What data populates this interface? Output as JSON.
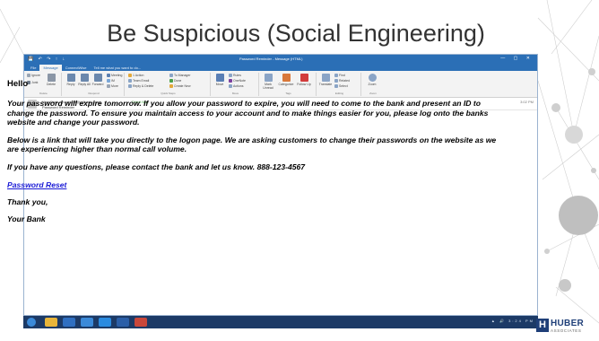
{
  "slide": {
    "title": "Be Suspicious (Social Engineering)"
  },
  "window": {
    "title": "Password Reminder - Message (HTML)",
    "tabs": [
      "File",
      "Message",
      "ConnectWise",
      "Tell me what you want to do..."
    ],
    "ribbon": {
      "delete_group": {
        "label": "Delete",
        "ignore": "Ignore",
        "junk": "Junk",
        "delete": "Delete"
      },
      "respond_group": {
        "label": "Respond",
        "reply": "Reply",
        "reply_all": "Reply All",
        "forward": "Forward",
        "meeting": "Meeting",
        "im": "IM",
        "more": "More"
      },
      "quick_steps_group": {
        "label": "Quick Steps",
        "items": [
          "1 Action",
          "Team Email",
          "Reply & Delete",
          "To Manager",
          "Done",
          "Create New"
        ]
      },
      "move_group": {
        "label": "Move",
        "move": "Move",
        "rules": "Rules",
        "onenote": "OneNote",
        "actions": "Actions"
      },
      "tags_group": {
        "label": "Tags",
        "mark_unread": "Mark Unread",
        "categorize": "Categorize",
        "follow_up": "Follow Up"
      },
      "editing_group": {
        "label": "Editing",
        "translate": "Translate",
        "find": "Find",
        "related": "Related",
        "select": "Select"
      },
      "zoom_group": {
        "label": "Zoom",
        "zoom": "Zoom"
      }
    },
    "header": {
      "from": "Your Bank <yourbank@ydbank.com>",
      "flag": "Direct flag",
      "subject": "Password Reminder",
      "time": "3:02 PM"
    }
  },
  "email": {
    "greeting": "Hello",
    "paragraphs": [
      "Your password will expire tomorrow.  If you allow your password to expire, you will need to come to the bank and present an ID to change the password.  To ensure you maintain access to your account and to make things easier for you, please log onto the banks website and change your password.",
      "Below is a link that will take you directly to the logon page.  We are asking customers to change their  passwords on the website as we are experiencing higher than normal call volume.",
      "If you have any questions, please contact the bank and let us know. 888-123-4567"
    ],
    "link_text": "Password Reset",
    "closing": "Thank you,",
    "signature": "Your Bank"
  },
  "taskbar": {
    "clock": "3:24 PM"
  },
  "logo": {
    "mark": "H",
    "name": "HUBER",
    "sub": "ASSOCIATES"
  },
  "colors": {
    "accent": "#2b6fb6",
    "taskbar": "#1c3a66",
    "link": "#1a1ad6",
    "logo": "#1f3f78"
  }
}
